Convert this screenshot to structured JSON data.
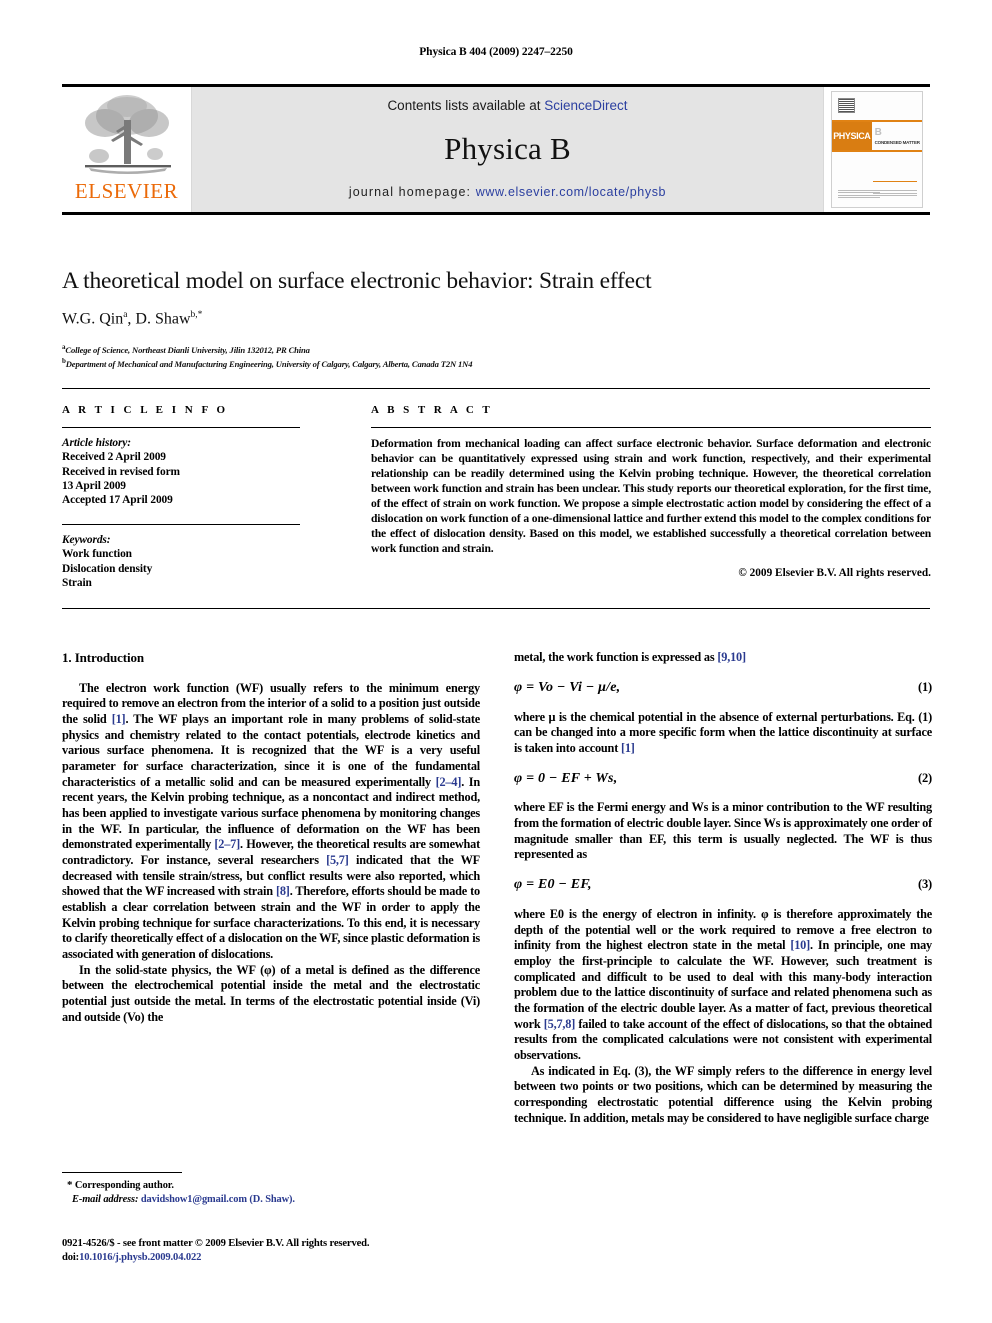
{
  "running_head": "Physica B 404 (2009) 2247–2250",
  "banner": {
    "publisher_name": "ELSEVIER",
    "contents_prefix": "Contents lists available at ",
    "contents_link": "ScienceDirect",
    "journal_name": "Physica B",
    "homepage_prefix": "journal homepage: ",
    "homepage_url": "www.elsevier.com/locate/physb",
    "cover": {
      "band_left": "PHYSICA",
      "band_right": "B",
      "band_sub": "CONDENSED MATTER"
    }
  },
  "article": {
    "title": "A theoretical model on surface electronic behavior: Strain effect",
    "authors": "W.G. Qin",
    "author_a_sup": "a",
    "authors_2": ", D. Shaw",
    "author_b_sup": "b,*",
    "affiliation_a_sup": "a",
    "affiliation_a": "College of Science, Northeast Dianli University, Jilin 132012, PR China",
    "affiliation_b_sup": "b",
    "affiliation_b": "Department of Mechanical and Manufacturing Engineering, University of Calgary, Calgary, Alberta, Canada T2N 1N4"
  },
  "info": {
    "heading": "A R T I C L E   I N F O",
    "history_label": "Article history:",
    "history": [
      "Received 2 April 2009",
      "Received in revised form",
      "13 April 2009",
      "Accepted 17 April 2009"
    ],
    "keywords_label": "Keywords:",
    "keywords": [
      "Work function",
      "Dislocation density",
      "Strain"
    ]
  },
  "abstract": {
    "heading": "A B S T R A C T",
    "text": "Deformation from mechanical loading can affect surface electronic behavior. Surface deformation and electronic behavior can be quantitatively expressed using strain and work function, respectively, and their experimental relationship can be readily determined using the Kelvin probing technique. However, the theoretical correlation between work function and strain has been unclear. This study reports our theoretical exploration, for the first time, of the effect of strain on work function. We propose a simple electrostatic action model by considering the effect of a dislocation on work function of a one-dimensional lattice and further extend this model to the complex conditions for the effect of dislocation density. Based on this model, we established successfully a theoretical correlation between work function and strain.",
    "copyright": "© 2009 Elsevier B.V. All rights reserved."
  },
  "body": {
    "section_number_title": "1.  Introduction",
    "left_p1_a": "The electron work function (WF) usually refers to the minimum energy required to remove an electron from the interior of a solid to a position just outside the solid ",
    "ref1": "[1]",
    "left_p1_b": ". The WF plays an important role in many problems of solid-state physics and chemistry related to the contact potentials, electrode kinetics and various surface phenomena. It is recognized that the WF is a very useful parameter for surface characterization, since it is one of the fundamental characteristics of a metallic solid and can be measured experimentally ",
    "ref2_4": "[2–4]",
    "left_p1_c": ". In recent years, the Kelvin probing technique, as a noncontact and indirect method, has been applied to investigate various surface phenomena by monitoring changes in the WF. In particular, the influence of deformation on the WF has been demonstrated experimentally ",
    "ref2_7": "[2–7]",
    "left_p1_d": ". However, the theoretical results are somewhat contradictory. For instance, several researchers ",
    "ref5_7": "[5,7]",
    "left_p1_e": " indicated that the WF decreased with tensile strain/stress, but conflict results were also reported, which showed that the WF increased with strain ",
    "ref8": "[8]",
    "left_p1_f": ". Therefore, efforts should be made to establish a clear correlation between strain and the WF in order to apply the Kelvin probing technique for surface characterizations. To this end, it is necessary to clarify theoretically effect of a dislocation on the WF, since plastic deformation is associated with generation of dislocations.",
    "left_p2": "In the solid-state physics, the WF (φ) of a metal is defined as the difference between the electrochemical potential inside the metal and the electrostatic potential just outside the metal. In terms of the electrostatic potential inside (Vi) and outside (Vo) the",
    "right_p1_a": "metal, the work function is expressed as ",
    "ref9_10": "[9,10]",
    "eq1_lhs": "φ = Vo − Vi − μ/e,",
    "eq1_num": "(1)",
    "right_p2_a": "where μ is the chemical potential in the absence of external perturbations. Eq. (1) can be changed into a more specific form when the lattice discontinuity at surface is taken into account ",
    "ref1b": "[1]",
    "eq2_lhs": "φ = 0 − EF + Ws,",
    "eq2_num": "(2)",
    "right_p3": "where EF is the Fermi energy and Ws is a minor contribution to the WF resulting from the formation of electric double layer. Since Ws is approximately one order of magnitude smaller than EF, this term is usually neglected. The WF is thus represented as",
    "eq3_lhs": "φ = E0 − EF,",
    "eq3_num": "(3)",
    "right_p4_a": "where E0 is the energy of electron in infinity. φ is therefore approximately the depth of the potential well or the work required to remove a free electron to infinity from the highest electron state in the metal ",
    "ref10": "[10]",
    "right_p4_b": ". In principle, one may employ the first-principle to calculate the WF. However, such treatment is complicated and difficult to be used to deal with this many-body interaction problem due to the lattice discontinuity of surface and related phenomena such as the formation of the electric double layer. As a matter of fact, previous theoretical work ",
    "ref5_7_8": "[5,7,8]",
    "right_p4_c": " failed to take account of the effect of dislocations, so that the obtained results from the complicated calculations were not consistent with experimental observations.",
    "right_p5": "As indicated in Eq. (3), the WF simply refers to the difference in energy level between two points or two positions, which can be determined by measuring the corresponding electrostatic potential difference using the Kelvin probing technique. In addition, metals may be considered to have negligible surface charge"
  },
  "footer": {
    "corresponding_star": "*",
    "corresponding_label": "Corresponding author.",
    "email_label": "E-mail address:",
    "email": " davidshow1@gmail.com (D. Shaw).",
    "issn_line": "0921-4526/$ - see front matter © 2009 Elsevier B.V. All rights reserved.",
    "doi_label": "doi:",
    "doi_value": "10.1016/j.physb.2009.04.022"
  },
  "colors": {
    "link_blue": "#2b3fa0",
    "ref_blue": "#2a3a8f",
    "elsevier_orange": "#eb6a09",
    "banner_gray": "#e4e4e4"
  }
}
